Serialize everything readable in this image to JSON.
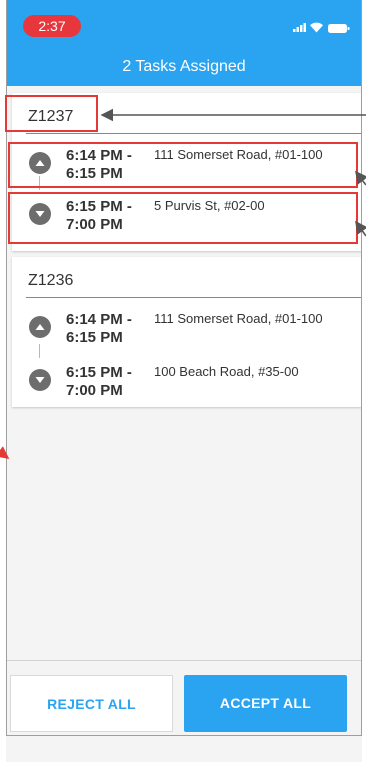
{
  "status_bar": {
    "time": "2:37"
  },
  "header": {
    "title": "2 Tasks Assigned"
  },
  "tasks": [
    {
      "id": "Z1237",
      "stops": [
        {
          "time": "6:14 PM - 6:15 PM",
          "address": "111 Somerset Road, #01-100"
        },
        {
          "time": "6:15 PM - 7:00 PM",
          "address": "5 Purvis St, #02-00"
        }
      ]
    },
    {
      "id": "Z1236",
      "stops": [
        {
          "time": "6:14 PM - 6:15 PM",
          "address": "111 Somerset Road, #01-100"
        },
        {
          "time": "6:15 PM - 7:00 PM",
          "address": "100 Beach Road, #35-00"
        }
      ]
    }
  ],
  "footer": {
    "reject_label": "REJECT ALL",
    "accept_label": "ACCEPT ALL"
  },
  "colors": {
    "accent": "#2aa3f1",
    "time_pill": "#e8363d",
    "annotation": "#e53935"
  },
  "icons": [
    "signal-icon",
    "wifi-icon",
    "battery-icon",
    "chevron-up-icon",
    "chevron-down-icon"
  ]
}
